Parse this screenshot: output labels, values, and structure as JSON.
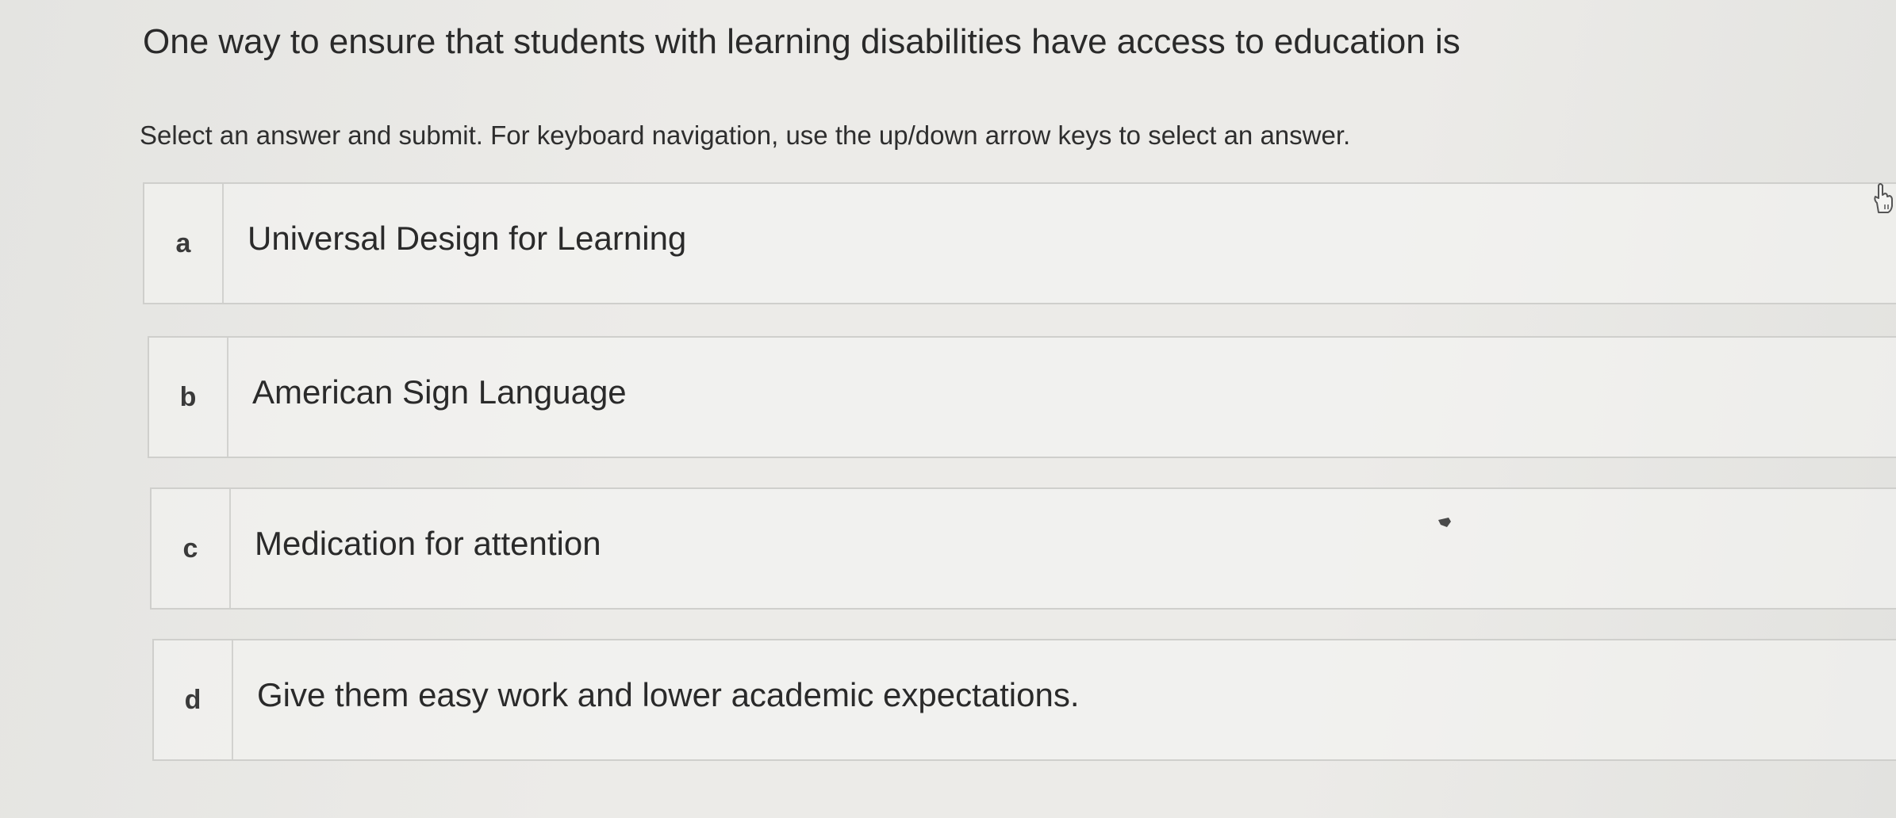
{
  "question": {
    "text": "One way to ensure that students with learning disabilities have access to education is"
  },
  "instructions": {
    "text": "Select an answer and submit. For keyboard navigation, use the up/down arrow keys to select an answer."
  },
  "options": [
    {
      "letter": "a",
      "text": "Universal Design for Learning"
    },
    {
      "letter": "b",
      "text": "American Sign Language"
    },
    {
      "letter": "c",
      "text": "Medication for attention"
    },
    {
      "letter": "d",
      "text": "Give them easy work and lower academic expectations."
    }
  ],
  "icons": {
    "cursor": "hand-pointer-icon"
  },
  "colors": {
    "background": "#ecebe8",
    "border": "#cfcfcc",
    "text": "#2a2a2a"
  }
}
